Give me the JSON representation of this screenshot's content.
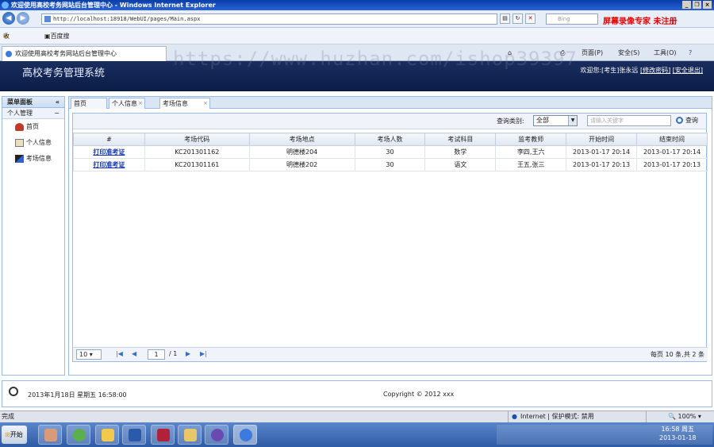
{
  "window": {
    "title": "欢迎使用高校考务网站后台管理中心 - Windows Internet Explorer"
  },
  "browser": {
    "url": "http://localhost:18918/WebUI/pages/Main.aspx",
    "search_placeholder": "Bing",
    "recorder_text": "屏幕录像专家 未注册",
    "favorites_label": "收藏夹",
    "favorite_item": "百度搜索_Excel C# N url",
    "tab_title": "欢迎使用高校考务网站后台管理中心",
    "toolbar": {
      "page": "页面(P)",
      "safety": "安全(S)",
      "tools": "工具(O)"
    }
  },
  "watermark": "https://www.huzhan.com/ishop39397",
  "app": {
    "title": "高校考务管理系统",
    "welcome_prefix": "欢迎您:",
    "user": "[考生]张永远",
    "change_password": "[修改密码]",
    "logout": "[安全退出]"
  },
  "sidebar": {
    "header": "菜单面板",
    "group": "个人管理",
    "items": [
      {
        "label": "首页"
      },
      {
        "label": "个人信息"
      },
      {
        "label": "考场信息"
      }
    ]
  },
  "tabs": [
    {
      "label": "首页"
    },
    {
      "label": "个人信息"
    },
    {
      "label": "考场信息"
    }
  ],
  "filter": {
    "label": "查询类别:",
    "selected": "全部",
    "keyword_placeholder": "请输入关键字",
    "query_button": "查询"
  },
  "table": {
    "columns": [
      "#",
      "考场代码",
      "考场地点",
      "考场人数",
      "考试科目",
      "监考教师",
      "开始时间",
      "结束时间"
    ],
    "rows": [
      [
        "打印准考证",
        "KC201301162",
        "明德楼204",
        "30",
        "数学",
        "李四,王六",
        "2013-01-17 20:14",
        "2013-01-17 20:14"
      ],
      [
        "打印准考证",
        "KC201301161",
        "明德楼202",
        "30",
        "语文",
        "王五,张三",
        "2013-01-17 20:13",
        "2013-01-17 20:13"
      ]
    ]
  },
  "pager": {
    "page_size": "10",
    "current_page": "1",
    "total": "/ 1",
    "info": "每页 10 条,共 2 条"
  },
  "footer": {
    "datetime": "2013年1月18日 星期五 16:58:00",
    "copyright": "Copyright © 2012 xxx"
  },
  "statusbar": {
    "status": "完成",
    "zone": "Internet | 保护模式: 禁用",
    "zoom": "100%"
  },
  "taskbar": {
    "start": "开始",
    "clock_time": "16:58 周五",
    "clock_date": "2013-01-18"
  }
}
